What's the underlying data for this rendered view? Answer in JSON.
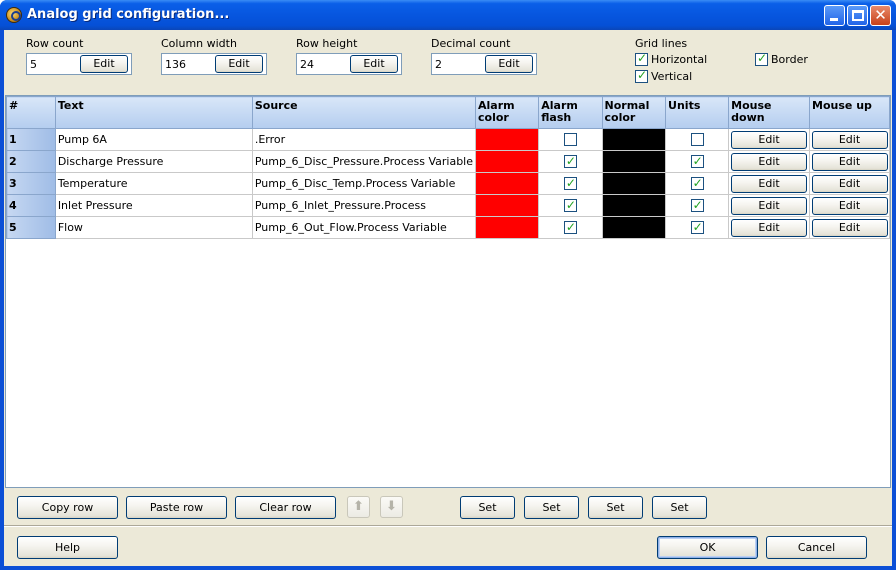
{
  "window": {
    "title": "Analog grid configuration..."
  },
  "settings": {
    "row_count": {
      "label": "Row count",
      "value": "5",
      "button": "Edit"
    },
    "column_width": {
      "label": "Column width",
      "value": "136",
      "button": "Edit"
    },
    "row_height": {
      "label": "Row height",
      "value": "24",
      "button": "Edit"
    },
    "decimal_count": {
      "label": "Decimal count",
      "value": "2",
      "button": "Edit"
    }
  },
  "grid_lines": {
    "label": "Grid lines",
    "horizontal": {
      "label": "Horizontal",
      "checked": true
    },
    "vertical": {
      "label": "Vertical",
      "checked": true
    },
    "border": {
      "label": "Border",
      "checked": true
    }
  },
  "table": {
    "columns": [
      "#",
      "Text",
      "Source",
      "Alarm color",
      "Alarm flash",
      "Normal color",
      "Units",
      "Mouse down",
      "Mouse up"
    ],
    "button_label": "Edit",
    "rows": [
      {
        "num": "1",
        "text": "Pump 6A",
        "source": ".Error",
        "alarm_color": "#ff0000",
        "alarm_flash": false,
        "normal_color": "#000000",
        "units": false
      },
      {
        "num": "2",
        "text": "Discharge Pressure",
        "source": "Pump_6_Disc_Pressure.Process Variable",
        "alarm_color": "#ff0000",
        "alarm_flash": true,
        "normal_color": "#000000",
        "units": true
      },
      {
        "num": "3",
        "text": "Temperature",
        "source": "Pump_6_Disc_Temp.Process Variable",
        "alarm_color": "#ff0000",
        "alarm_flash": true,
        "normal_color": "#000000",
        "units": true
      },
      {
        "num": "4",
        "text": "Inlet Pressure",
        "source": "Pump_6_Inlet_Pressure.Process",
        "alarm_color": "#ff0000",
        "alarm_flash": true,
        "normal_color": "#000000",
        "units": true
      },
      {
        "num": "5",
        "text": "Flow",
        "source": "Pump_6_Out_Flow.Process Variable",
        "alarm_color": "#ff0000",
        "alarm_flash": true,
        "normal_color": "#000000",
        "units": true
      }
    ]
  },
  "toolbar": {
    "copy_row": "Copy row",
    "paste_row": "Paste row",
    "clear_row": "Clear row",
    "move_up_icon": "arrow-up-icon",
    "move_down_icon": "arrow-down-icon",
    "set_buttons": [
      "Set",
      "Set",
      "Set",
      "Set"
    ]
  },
  "footer": {
    "help": "Help",
    "ok": "OK",
    "cancel": "Cancel"
  }
}
